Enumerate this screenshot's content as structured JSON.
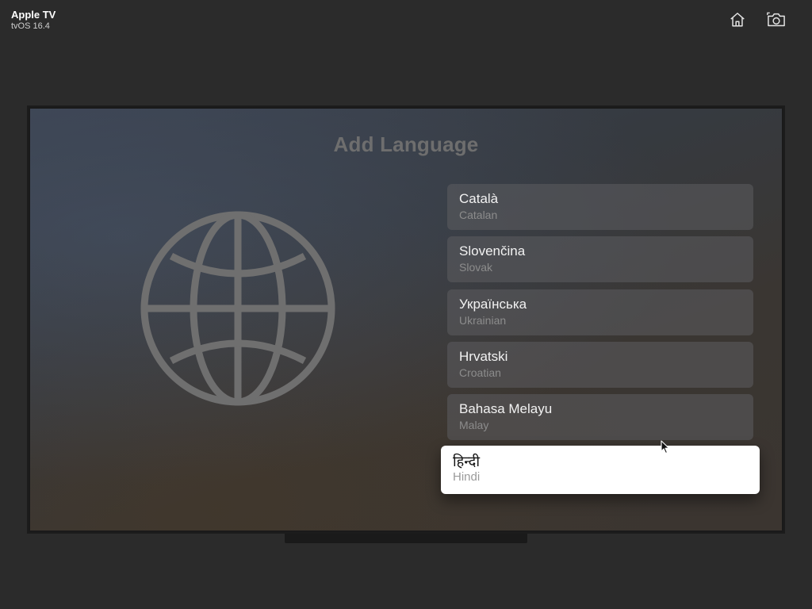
{
  "simulator": {
    "device_name": "Apple TV",
    "os_version": "tvOS 16.4",
    "toolbar": {
      "home_icon": "home-icon",
      "screenshot_icon": "camera-icon"
    }
  },
  "screen": {
    "title": "Add Language",
    "globe_icon": "globe-icon",
    "languages": [
      {
        "native": "Català",
        "english": "Catalan",
        "focused": false
      },
      {
        "native": "Slovenčina",
        "english": "Slovak",
        "focused": false
      },
      {
        "native": "Українська",
        "english": "Ukrainian",
        "focused": false
      },
      {
        "native": "Hrvatski",
        "english": "Croatian",
        "focused": false
      },
      {
        "native": "Bahasa Melayu",
        "english": "Malay",
        "focused": false
      },
      {
        "native": "हिन्दी",
        "english": "Hindi",
        "focused": true
      }
    ]
  },
  "colors": {
    "background": "#2b2b2b",
    "focused_item": "#ffffff",
    "item": "#5c5c60",
    "title": "#6e6e6e"
  }
}
